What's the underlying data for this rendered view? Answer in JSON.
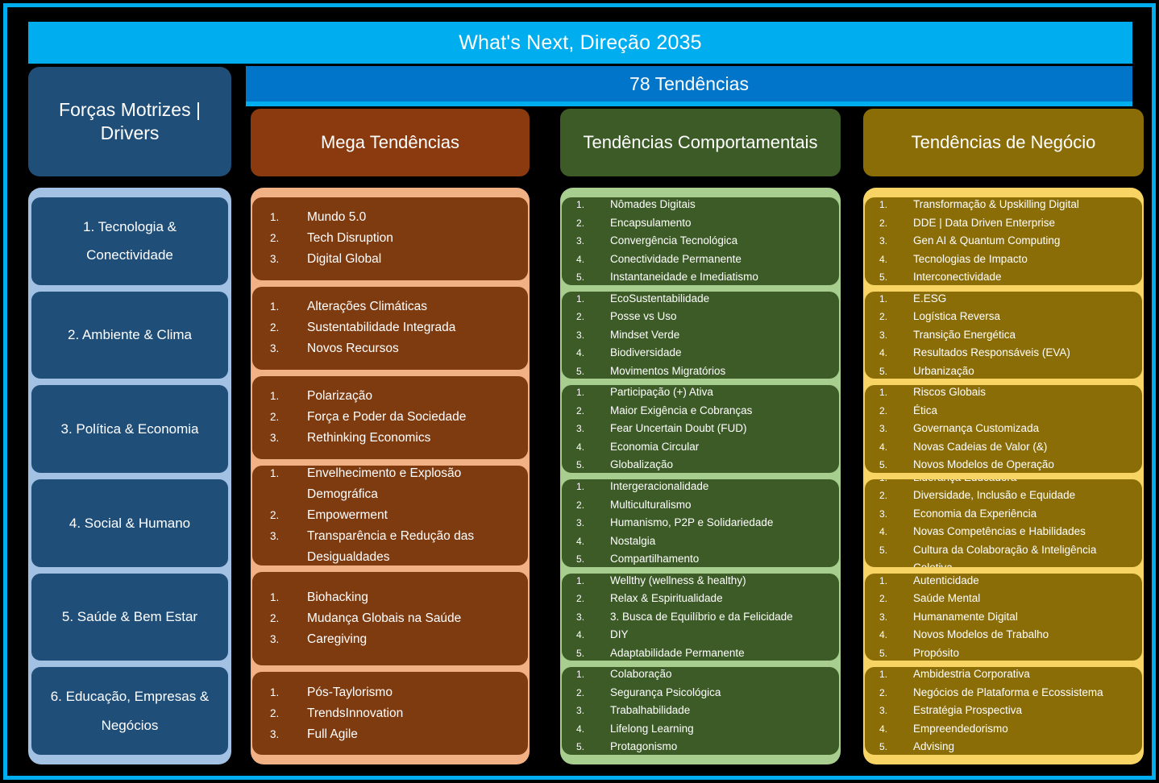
{
  "title_bar": {
    "title": "What's Next, Direção 2035"
  },
  "sub_bar": {
    "label": "78 Tendências"
  },
  "columns": {
    "drivers": {
      "header": "Forças Motrizes | Drivers",
      "items": [
        "1. Tecnologia & Conectividade",
        "2. Ambiente & Clima",
        "3. Política & Economia",
        "4. Social & Humano",
        "5. Saúde & Bem Estar",
        "6. Educação, Empresas & Negócios"
      ]
    },
    "mega": {
      "header": "Mega Tendências",
      "groups": [
        {
          "items": [
            "Mundo 5.0",
            "Tech Disruption",
            "Digital Global"
          ]
        },
        {
          "items": [
            "Alterações Climáticas",
            "Sustentabilidade Integrada",
            "Novos Recursos"
          ]
        },
        {
          "items": [
            "Polarização",
            "Força e Poder da Sociedade",
            "Rethinking Economics"
          ]
        },
        {
          "items": [
            "Envelhecimento e Explosão Demográfica",
            "Empowerment",
            "Transparência e Redução das Desigualdades"
          ]
        },
        {
          "items": [
            "Biohacking",
            "Mudança Globais na Saúde",
            "Caregiving"
          ]
        },
        {
          "items": [
            "Pós-Taylorismo",
            "TrendsInnovation",
            "Full Agile"
          ]
        }
      ]
    },
    "behavioral": {
      "header": "Tendências Comportamentais",
      "groups": [
        {
          "items": [
            "Nômades Digitais",
            "Encapsulamento",
            "Convergência Tecnológica",
            "Conectividade Permanente",
            "Instantaneidade e Imediatismo"
          ]
        },
        {
          "items": [
            "EcoSustentabilidade",
            "Posse vs Uso",
            "Mindset Verde",
            "Biodiversidade",
            "Movimentos Migratórios"
          ]
        },
        {
          "items": [
            "Participação (+) Ativa",
            "Maior Exigência e Cobranças",
            "Fear Uncertain Doubt (FUD)",
            "Economia Circular",
            "Globalização"
          ]
        },
        {
          "items": [
            "Intergeracionalidade",
            "Multiculturalismo",
            "Humanismo, P2P e Solidariedade",
            "Nostalgia",
            "Compartilhamento"
          ]
        },
        {
          "items": [
            "Wellthy (wellness & healthy)",
            "Relax & Espiritualidade",
            "3. Busca de Equilíbrio e da Felicidade",
            "DIY",
            "Adaptabilidade Permanente"
          ]
        },
        {
          "items": [
            "Colaboração",
            "Segurança Psicológica",
            "Trabalhabilidade",
            "Lifelong Learning",
            "Protagonismo"
          ]
        }
      ]
    },
    "business": {
      "header": "Tendências de Negócio",
      "groups": [
        {
          "items": [
            "Transformação & Upskilling Digital",
            "DDE | Data Driven Enterprise",
            "Gen AI & Quantum Computing",
            "Tecnologias de Impacto",
            "Interconectividade"
          ]
        },
        {
          "items": [
            "E.ESG",
            "Logística Reversa",
            "Transição Energética",
            "Resultados Responsáveis (EVA)",
            "Urbanização"
          ]
        },
        {
          "items": [
            "Riscos Globais",
            "Ética",
            "Governança Customizada",
            "Novas Cadeias de Valor (&)",
            "Novos Modelos de Operação"
          ]
        },
        {
          "items": [
            "Liderança Educadora",
            "Diversidade, Inclusão e Equidade",
            "Economia da Experiência",
            "Novas Competências e Habilidades",
            "Cultura da Colaboração & Inteligência Coletiva"
          ]
        },
        {
          "items": [
            "Autenticidade",
            "Saúde Mental",
            "Humanamente Digital",
            "Novos Modelos de Trabalho",
            "Propósito"
          ]
        },
        {
          "items": [
            "Ambidestria Corporativa",
            "Negócios de Plataforma e Ecossistema",
            "Estratégia Prospectiva",
            "Empreendedorismo",
            "Advising"
          ]
        }
      ]
    }
  },
  "colors": {
    "frame": "#00AEEF",
    "title_bar": "#00AEEF",
    "sub_bar": "#0075C9",
    "drivers_header": "#1F4E79",
    "drivers_body": "#A3C2E3",
    "mega_header": "#8A3A0E",
    "mega_body": "#F2B085",
    "mega_card": "#7E3B10",
    "behavioral_header": "#3C5B26",
    "behavioral_body": "#A8CE8F",
    "behavioral_card": "#3C5B26",
    "business_header": "#8A6D07",
    "business_body": "#F7D464",
    "business_card": "#8A6D07",
    "background": "#000000"
  }
}
